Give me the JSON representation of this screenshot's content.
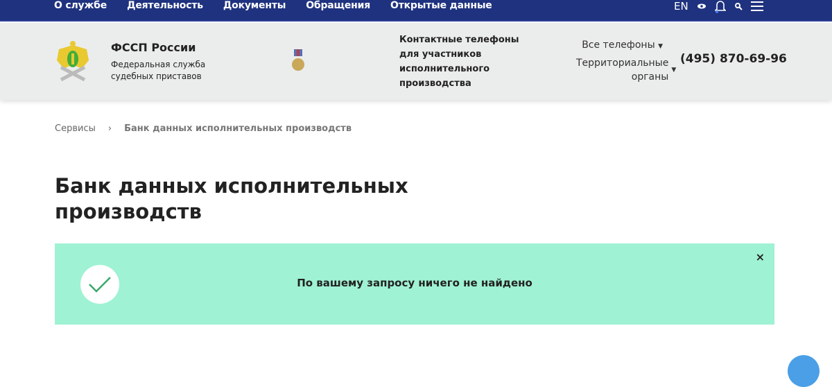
{
  "topnav": {
    "items": [
      "О службе",
      "Деятельность",
      "Документы",
      "Обращения",
      "Открытые данные"
    ],
    "lang": "EN"
  },
  "header": {
    "title": "ФССП России",
    "subtitle": "Федеральная служба судебных приставов",
    "contact_label": "Контактные телефоны для участников исполнительного производства",
    "all_phones": "Все телефоны",
    "territorial": "Территориальные органы",
    "phone": "(495) 870-69-96"
  },
  "breadcrumb": {
    "items": [
      "Сервисы",
      "Банк данных исполнительных производств"
    ],
    "separator": "›"
  },
  "page": {
    "title": "Банк данных исполнительных производств"
  },
  "alert": {
    "message": "По вашему запросу ничего не найдено",
    "close": "×"
  },
  "colors": {
    "nav": "#1f327f",
    "alert": "#9ff2d3",
    "call": "#4a9fe6"
  }
}
